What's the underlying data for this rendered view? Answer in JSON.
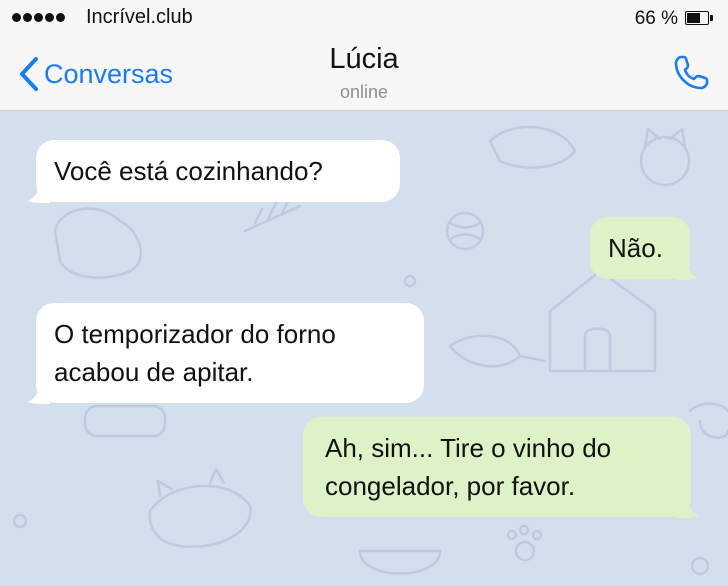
{
  "status_bar": {
    "carrier": "Incrível.club",
    "battery_percent_label": "66 %",
    "battery_level": 0.66,
    "signal_bars": 5
  },
  "header": {
    "back_label": "Conversas",
    "contact_name": "Lúcia",
    "contact_status": "online",
    "back_icon": "chevron-left-icon",
    "call_icon": "phone-icon"
  },
  "messages": [
    {
      "direction": "incoming",
      "text": "Você está cozinhando?"
    },
    {
      "direction": "outgoing",
      "text": "Não."
    },
    {
      "direction": "incoming",
      "text": "O temporizador do forno\nacabou de apitar."
    },
    {
      "direction": "outgoing",
      "text": "Ah, sim... Tire o vinho do\ncongelador, por favor."
    }
  ],
  "colors": {
    "accent": "#1a7cf0",
    "chat_background": "#d4dfee",
    "incoming_bubble": "#ffffff",
    "outgoing_bubble": "#def2c8"
  }
}
